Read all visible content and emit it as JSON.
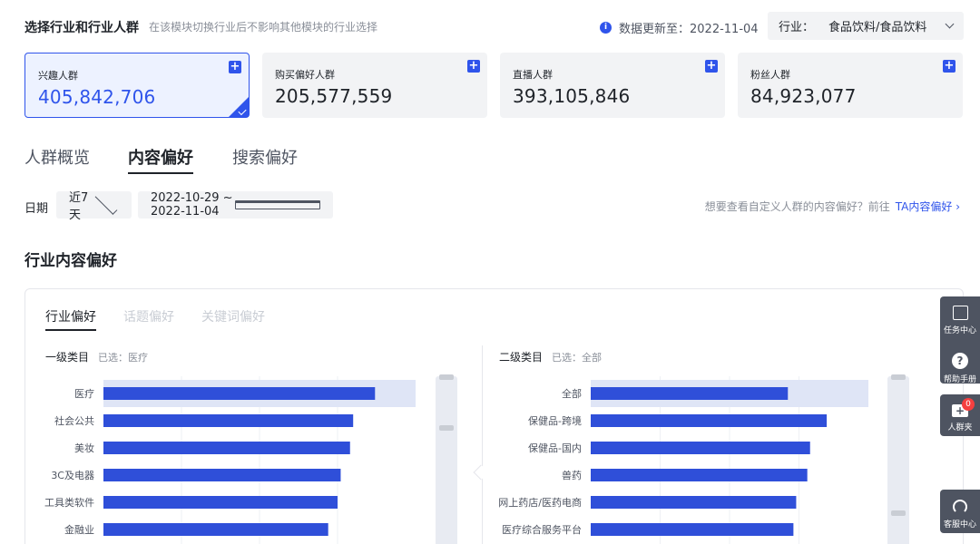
{
  "header": {
    "title": "选择行业和行业人群",
    "hint": "在该模块切换行业后不影响其他模块的行业选择",
    "update_label": "数据更新至：2022-11-04",
    "industry_label": "行业：",
    "industry_value": "食品饮料/食品饮料"
  },
  "cards": [
    {
      "name": "兴趣人群",
      "value": "405,842,706"
    },
    {
      "name": "购买偏好人群",
      "value": "205,577,559"
    },
    {
      "name": "直播人群",
      "value": "393,105,846"
    },
    {
      "name": "粉丝人群",
      "value": "84,923,077"
    }
  ],
  "main_tabs": [
    "人群概览",
    "内容偏好",
    "搜索偏好"
  ],
  "filters": {
    "date_label": "日期",
    "range_value": "近7天",
    "date_range": "2022-10-29 ~ 2022-11-04",
    "ta_hint": "想要查看自定义人群的内容偏好？前往",
    "ta_link": "TA内容偏好 ›"
  },
  "section": {
    "title": "行业内容偏好",
    "sub_tabs": [
      "行业偏好",
      "话题偏好",
      "关键词偏好"
    ]
  },
  "primary": {
    "title": "一级类目",
    "selected": "已选：医疗"
  },
  "secondary": {
    "title": "二级类目",
    "selected": "已选：全部"
  },
  "chart_data": [
    {
      "type": "bar",
      "orientation": "horizontal",
      "title": "一级类目",
      "categories": [
        "医疗",
        "社会公共",
        "美妆",
        "3C及电器",
        "工具类软件",
        "金融业"
      ],
      "values": [
        0.87,
        0.8,
        0.79,
        0.76,
        0.75,
        0.72
      ],
      "highlighted": "医疗",
      "color": "#2f4fd9"
    },
    {
      "type": "bar",
      "orientation": "horizontal",
      "title": "二级类目",
      "categories": [
        "全部",
        "保健品-跨境",
        "保健品-国内",
        "兽药",
        "网上药店/医药电商",
        "医疗综合服务平台"
      ],
      "values": [
        0.71,
        0.85,
        0.79,
        0.78,
        0.74,
        0.73
      ],
      "highlighted": "全部",
      "color": "#2f4fd9"
    }
  ],
  "sidebar": [
    {
      "label": "任务中心"
    },
    {
      "label": "帮助手册"
    },
    {
      "label": "人群夹",
      "badge": "0"
    },
    {
      "label": "客服中心"
    }
  ]
}
